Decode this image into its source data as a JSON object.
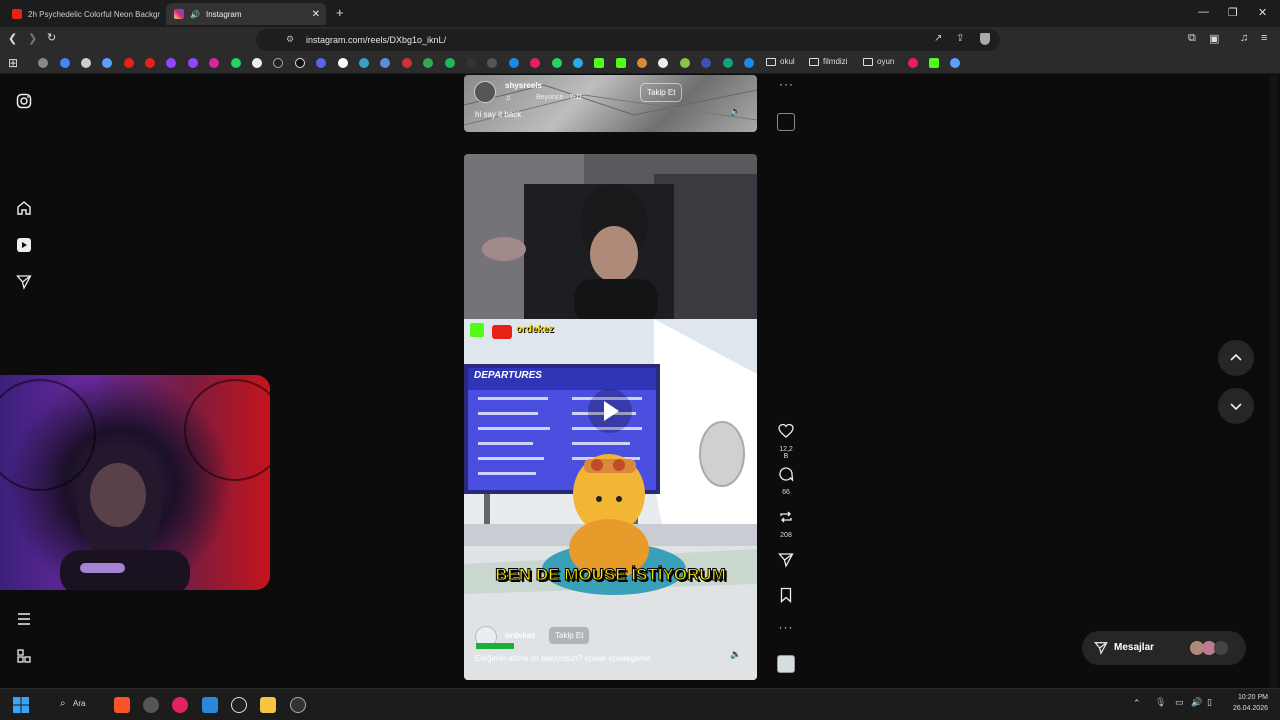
{
  "browser": {
    "tabs": [
      {
        "title": "2h Psychedelic Colorful Neon Backgr",
        "favicon_color": "#e62117",
        "active": false
      },
      {
        "title": "Instagram",
        "favicon_color": "#d6249f",
        "active": true
      }
    ],
    "new_tab_label": "+",
    "url": "instagram.com/reels/DXbg1o_iknL/",
    "bookmark_folders": [
      "okul",
      "filmdizi",
      "oyun"
    ],
    "window_controls": [
      "minimize-icon",
      "restore-icon",
      "close-icon"
    ]
  },
  "instagram": {
    "sidebar_icons": [
      "instagram-logo-icon",
      "home-icon",
      "reels-icon",
      "messages-icon",
      "menu-icon",
      "meta-icon"
    ],
    "reel_top": {
      "username": "shysreels",
      "music": "Beyoncé · 7/11",
      "follow_label": "Takip Et",
      "caption": "hi say it back"
    },
    "reel_main": {
      "overlay_channel": "ordekez",
      "overlay_sign": "DEPARTURES",
      "subtitle": "BEN DE MOUSE İSTİYORUM",
      "username": "ordekez",
      "follow_label": "Takip Et",
      "caption": "Eteğimin altına mı bakıyosun? #peak #peakgame"
    },
    "actions": [
      {
        "icon": "heart-icon",
        "count": "12,2 B"
      },
      {
        "icon": "comment-icon",
        "count": "66"
      },
      {
        "icon": "repost-icon",
        "count": "208"
      },
      {
        "icon": "share-icon",
        "count": ""
      },
      {
        "icon": "bookmark-icon",
        "count": ""
      },
      {
        "icon": "more-icon",
        "count": ""
      }
    ],
    "messages_label": "Mesajlar"
  },
  "taskbar": {
    "search_label": "Ara",
    "time": "10:20 PM",
    "date": "26.04.2026"
  }
}
